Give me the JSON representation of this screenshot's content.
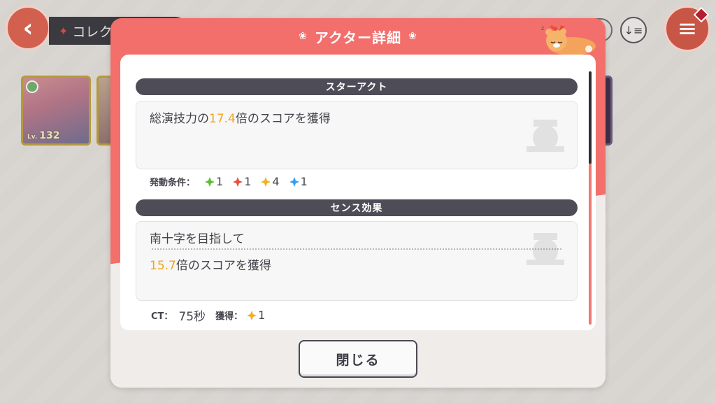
{
  "background": {
    "header_tab_label": "コレク",
    "cards": [
      {
        "level": "132"
      }
    ]
  },
  "dialog": {
    "title": "アクター詳細",
    "star_act": {
      "section_label": "スターアクト",
      "desc_prefix": "総演技力の",
      "desc_multiplier": "17.4",
      "desc_suffix": "倍のスコアを獲得",
      "condition_label": "発動条件：",
      "conditions": [
        {
          "color": "#5bbf2d",
          "icon": "green-sparkle-icon",
          "count": "1"
        },
        {
          "color": "#e8503e",
          "icon": "red-sparkle-icon",
          "count": "1"
        },
        {
          "color": "#f2b21c",
          "icon": "yellow-sparkle-icon",
          "count": "4"
        },
        {
          "color": "#3a9ef0",
          "icon": "blue-sparkle-icon",
          "count": "1"
        }
      ]
    },
    "sense": {
      "section_label": "センス効果",
      "name": "南十字を目指して",
      "multiplier": "15.7",
      "desc_suffix": "倍のスコアを獲得",
      "ct_label": "CT：",
      "ct_value": "75秒",
      "gain_label": "獲得：",
      "gain_icon": "yellow-sparkle-icon",
      "gain_color": "#f2b21c",
      "gain_count": "1"
    },
    "close_label": "閉じる"
  },
  "colors": {
    "accent_red": "#f26f6c",
    "highlight": "#f0a51c",
    "section_bar": "#4d4c57"
  }
}
